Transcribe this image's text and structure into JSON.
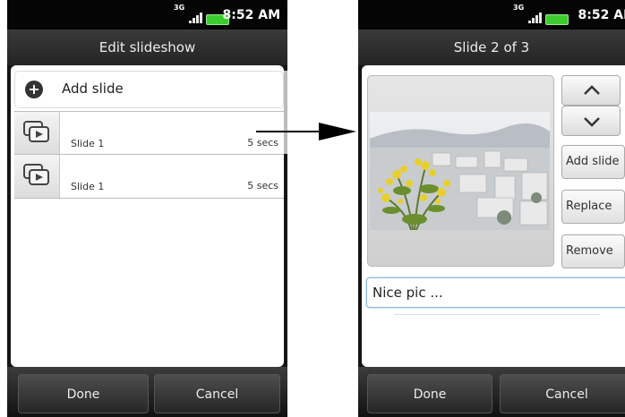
{
  "left": {
    "status": {
      "net": "3G",
      "time": "8:52 AM"
    },
    "title": "Edit slideshow",
    "add_slide": "Add slide",
    "slides": [
      {
        "name": "Slide 1",
        "duration": "5 secs"
      },
      {
        "name": "Slide 1",
        "duration": "5 secs"
      }
    ],
    "done": "Done",
    "cancel": "Cancel"
  },
  "right": {
    "status": {
      "net": "3G",
      "time": "8:52 AM"
    },
    "title": "Slide 2 of 3",
    "buttons": {
      "add_slide": "Add slide",
      "replace": "Replace",
      "remove": "Remove"
    },
    "caption": "Nice pic ...",
    "done": "Done",
    "cancel": "Cancel"
  },
  "colors": {
    "battery": "#3ccd2c",
    "arrow": "#000000",
    "caption_focus": "#8ab6e6"
  }
}
